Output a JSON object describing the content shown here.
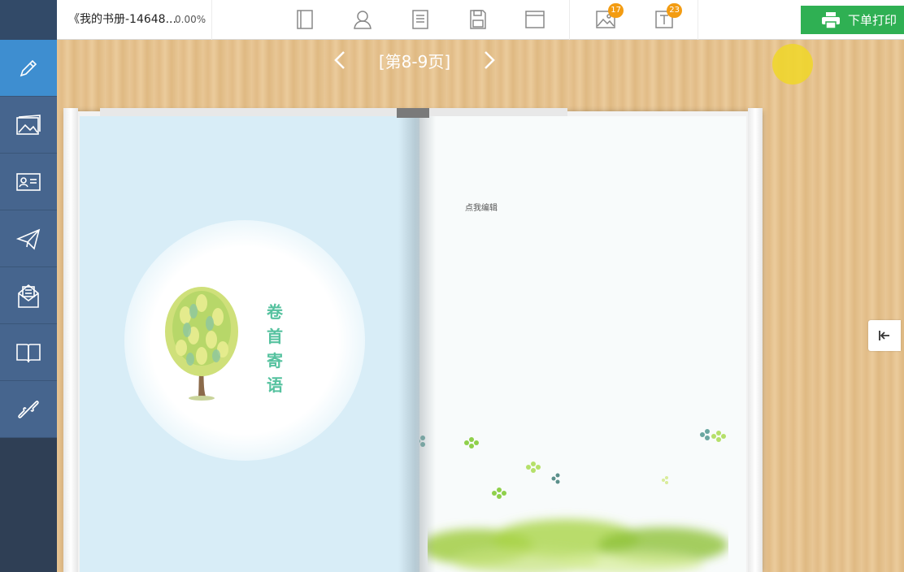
{
  "header": {
    "title": "《我的书册-14648...",
    "progress": "0.00%",
    "tools": [
      {
        "name": "book-cover-icon"
      },
      {
        "name": "author-icon"
      },
      {
        "name": "page-template-icon"
      },
      {
        "name": "save-icon"
      },
      {
        "name": "window-icon"
      },
      {
        "name": "image-icon",
        "badge": "17"
      },
      {
        "name": "text-icon",
        "badge": "23"
      }
    ],
    "print_label": "下单打印"
  },
  "sidebar": {
    "items": [
      {
        "name": "edit-icon",
        "active": true
      },
      {
        "name": "photo-icon",
        "active": false
      },
      {
        "name": "id-card-icon",
        "active": false
      },
      {
        "name": "send-icon",
        "active": false
      },
      {
        "name": "mail-icon",
        "active": false
      },
      {
        "name": "open-book-icon",
        "active": false
      },
      {
        "name": "link-icon",
        "active": false
      }
    ]
  },
  "pager": {
    "label": "[第8-9页]"
  },
  "left_page": {
    "verse": [
      "卷",
      "首",
      "寄",
      "语"
    ]
  },
  "right_page": {
    "edit_hint": "点我编辑"
  },
  "colors": {
    "sidebar_bg": "#2f3f55",
    "sidebar_item": "#46658e",
    "sidebar_active": "#3e8ed0",
    "print_button": "#2fb053",
    "badge": "#f39c12",
    "verse_text": "#56c29f"
  }
}
